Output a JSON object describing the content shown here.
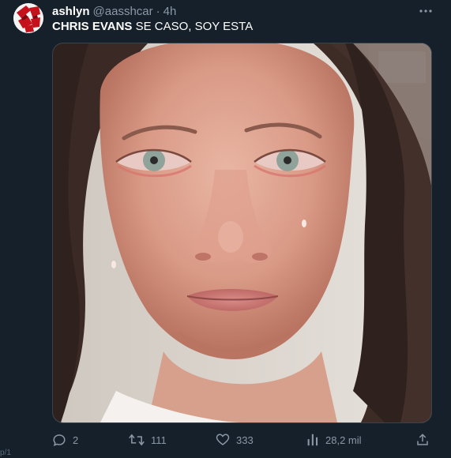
{
  "tweet": {
    "author": {
      "display_name": "ashlyn",
      "handle": "@aasshcar",
      "avatar_icon": "red-pattern-avatar"
    },
    "separator": "·",
    "timestamp": "4h",
    "text_bold": "CHRIS EVANS",
    "text_rest": " SE CASO, SOY ESTA",
    "media": {
      "description_icon": "photo-crying-woman"
    },
    "actions": {
      "reply_count": "2",
      "retweet_count": "111",
      "like_count": "333",
      "views_count": "28,2 mil"
    }
  },
  "corner_fragment": "p/1",
  "colors": {
    "background": "#15202b",
    "muted_text": "#8b98a5",
    "border": "#38444d"
  }
}
